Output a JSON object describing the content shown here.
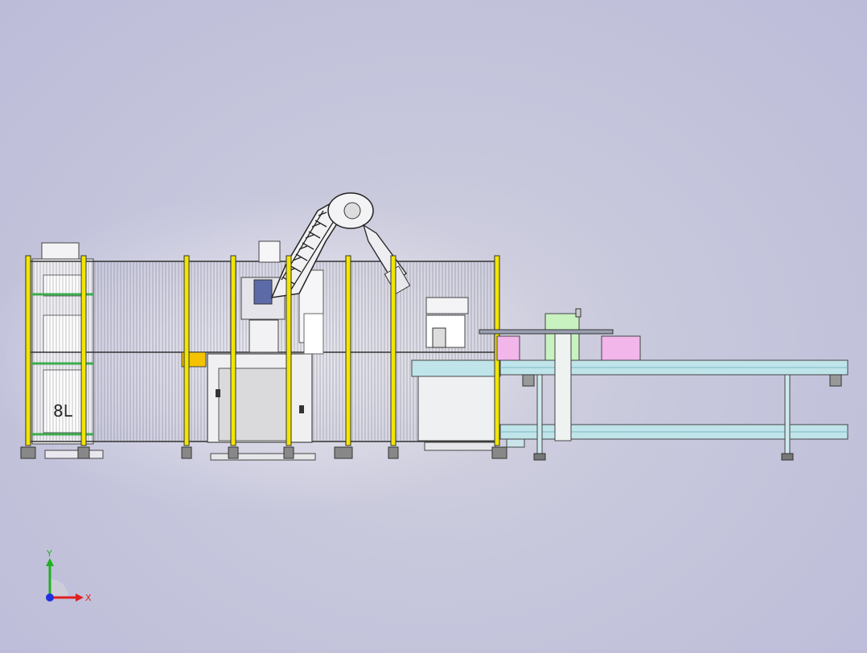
{
  "viewport": {
    "bin_label": "8L",
    "colors": {
      "background": "#c3c3dd",
      "fence_post": "#f2e600",
      "mesh": "#5a5a66",
      "conveyor": "#bfe4ea",
      "pink_tote": "#f2b6ea",
      "green_box": "#c8f2c0",
      "robot": "#f2f2f4"
    }
  },
  "triad": {
    "x_label": "X",
    "y_label": "Y",
    "x_color": "#e02020",
    "y_color": "#20b020",
    "z_color": "#2030e0"
  }
}
